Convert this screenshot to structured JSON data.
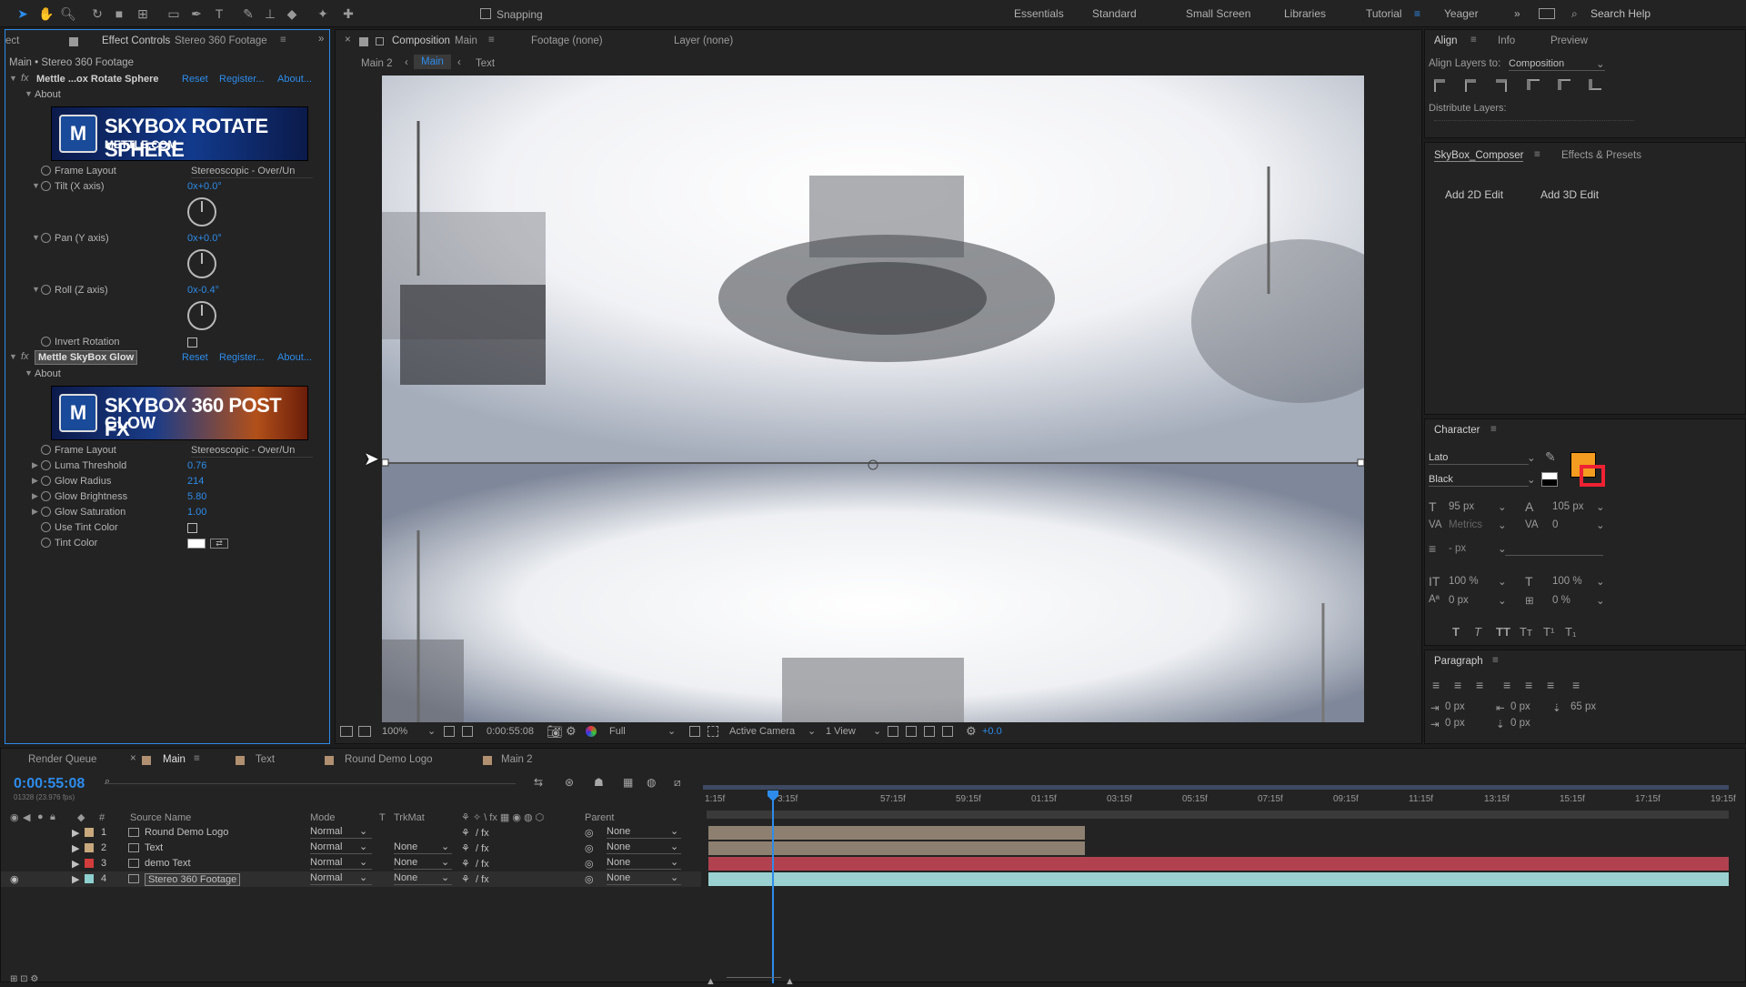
{
  "toolbar": {
    "snapping": "Snapping",
    "workspaces": [
      "Essentials",
      "Standard",
      "Small Screen",
      "Libraries",
      "Tutorial",
      "Yeager"
    ],
    "active_workspace": "Tutorial",
    "search_placeholder": "Search Help"
  },
  "effect_panel": {
    "tab_prefix": "ect",
    "tab_label": "Effect Controls",
    "tab_layer": "Stereo 360 Footage",
    "breadcrumb": "Main • Stereo 360 Footage",
    "fx1": {
      "name": "Mettle ...ox Rotate Sphere",
      "reset": "Reset",
      "register": "Register...",
      "about": "About...",
      "about_label": "About",
      "banner_title": "SKYBOX ROTATE SPHERE",
      "banner_sub": "METTLE.COM",
      "frame_layout_label": "Frame Layout",
      "frame_layout_value": "Stereoscopic - Over/Un",
      "tilt_label": "Tilt (X axis)",
      "tilt_value": "0x+0.0°",
      "pan_label": "Pan (Y axis)",
      "pan_value": "0x+0.0°",
      "roll_label": "Roll (Z axis)",
      "roll_value": "0x-0.4°",
      "invert_label": "Invert Rotation"
    },
    "fx2": {
      "name": "Mettle SkyBox Glow",
      "reset": "Reset",
      "register": "Register...",
      "about": "About...",
      "about_label": "About",
      "banner_title": "SKYBOX 360 POST FX",
      "banner_sub": "GLOW",
      "frame_layout_label": "Frame Layout",
      "frame_layout_value": "Stereoscopic - Over/Un",
      "luma_label": "Luma Threshold",
      "luma_value": "0.76",
      "radius_label": "Glow Radius",
      "radius_value": "214",
      "bright_label": "Glow Brightness",
      "bright_value": "5.80",
      "sat_label": "Glow Saturation",
      "sat_value": "1.00",
      "use_tint_label": "Use Tint Color",
      "tint_label": "Tint Color"
    }
  },
  "viewer": {
    "comp_tab": "Composition",
    "comp_name": "Main",
    "footage_tab": "Footage (none)",
    "layer_tab": "Layer (none)",
    "crumbs": [
      "Main 2",
      "Main",
      "Text"
    ],
    "zoom": "100%",
    "timecode": "0:00:55:08",
    "resolution": "Full",
    "camera": "Active Camera",
    "views": "1 View",
    "exposure": "+0.0"
  },
  "right_panel": {
    "tabs": [
      "Align",
      "Info",
      "Preview"
    ],
    "align_to_label": "Align Layers to:",
    "align_to_value": "Composition",
    "distribute_label": "Distribute Layers:",
    "skybox_tab": "SkyBox_Composer",
    "effects_tab": "Effects & Presets",
    "add2d": "Add 2D Edit",
    "add3d": "Add 3D Edit",
    "character": {
      "title": "Character",
      "font": "Lato",
      "style": "Black",
      "size": "95 px",
      "leading": "105 px",
      "kerning": "Metrics",
      "tracking": "0",
      "stroke": "- px",
      "vscale": "100 %",
      "hscale": "100 %",
      "baseline": "0 px",
      "tsume": "0 %",
      "fill_color": "#f39c1f"
    },
    "paragraph": {
      "title": "Paragraph",
      "indent_left": "0 px",
      "indent_first": "0 px",
      "space_before": "65 px",
      "indent_right": "0 px",
      "space_after": "0 px"
    }
  },
  "timeline": {
    "tabs": [
      "Render Queue",
      "Main",
      "Text",
      "Round Demo Logo",
      "Main 2"
    ],
    "active_tab": "Main",
    "timecode": "0:00:55:08",
    "frames": "01328 (23.976 fps)",
    "columns": {
      "num": "#",
      "source": "Source Name",
      "mode": "Mode",
      "t": "T",
      "trkmat": "TrkMat",
      "parent": "Parent"
    },
    "layers": [
      {
        "num": "1",
        "name": "Round Demo Logo",
        "mode": "Normal",
        "trkmat": "",
        "parent": "None",
        "color": "#c8a87c"
      },
      {
        "num": "2",
        "name": "Text",
        "mode": "Normal",
        "trkmat": "None",
        "parent": "None",
        "color": "#c8a87c"
      },
      {
        "num": "3",
        "name": "demo Text",
        "mode": "Normal",
        "trkmat": "None",
        "parent": "None",
        "color": "#d23c3c"
      },
      {
        "num": "4",
        "name": "Stereo 360 Footage",
        "mode": "Normal",
        "trkmat": "None",
        "parent": "None",
        "color": "#8ecfcf"
      }
    ],
    "ruler": [
      "1:15f",
      "3:15f",
      "57:15f",
      "59:15f",
      "01:15f",
      "03:15f",
      "05:15f",
      "07:15f",
      "09:15f",
      "11:15f",
      "13:15f",
      "15:15f",
      "17:15f",
      "19:15f"
    ]
  }
}
